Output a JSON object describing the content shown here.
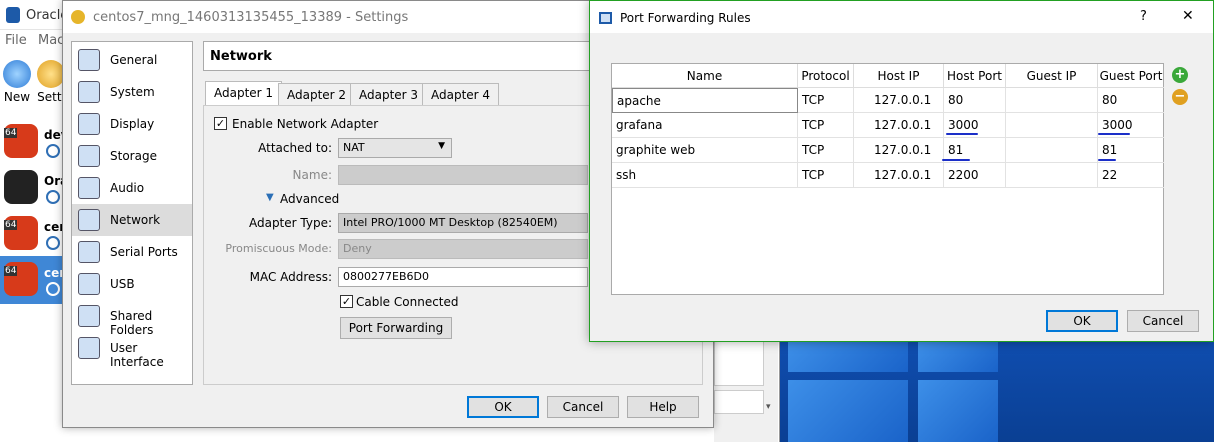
{
  "main_window": {
    "title": "Oracle",
    "menu": [
      "File",
      "Mac"
    ],
    "toolbar": {
      "new_label": "New",
      "settings_label": "Setti"
    },
    "vms": [
      {
        "badge": "64",
        "name": "dev",
        "selected": false
      },
      {
        "badge": "",
        "name": "Ora",
        "selected": false
      },
      {
        "badge": "64",
        "name": "cen",
        "selected": false
      },
      {
        "badge": "64",
        "name": "cen",
        "selected": true
      }
    ]
  },
  "settings": {
    "title": "centos7_mng_1460313135455_13389 - Settings",
    "categories": [
      {
        "label": "General",
        "icon": "general-icon"
      },
      {
        "label": "System",
        "icon": "system-icon"
      },
      {
        "label": "Display",
        "icon": "display-icon"
      },
      {
        "label": "Storage",
        "icon": "storage-icon"
      },
      {
        "label": "Audio",
        "icon": "audio-icon"
      },
      {
        "label": "Network",
        "icon": "network-icon",
        "selected": true
      },
      {
        "label": "Serial Ports",
        "icon": "serial-ports-icon"
      },
      {
        "label": "USB",
        "icon": "usb-icon"
      },
      {
        "label": "Shared Folders",
        "icon": "shared-folders-icon"
      },
      {
        "label": "User Interface",
        "icon": "user-interface-icon"
      }
    ],
    "section_title": "Network",
    "tabs": [
      "Adapter 1",
      "Adapter 2",
      "Adapter 3",
      "Adapter 4"
    ],
    "enable_adapter_label": "Enable Network Adapter",
    "attached_to_label": "Attached to:",
    "attached_to_value": "NAT",
    "name_label": "Name:",
    "advanced_label": "Advanced",
    "adapter_type_label": "Adapter Type:",
    "adapter_type_value": "Intel PRO/1000 MT Desktop (82540EM)",
    "promiscuous_label": "Promiscuous Mode:",
    "promiscuous_value": "Deny",
    "mac_label": "MAC Address:",
    "mac_value": "0800277EB6D0",
    "cable_label": "Cable Connected",
    "port_forwarding_label": "Port Forwarding",
    "ok_label": "OK",
    "cancel_label": "Cancel",
    "help_label": "Help"
  },
  "port_forwarding": {
    "title": "Port Forwarding Rules",
    "help_glyph": "?",
    "close_glyph": "✕",
    "columns": [
      "Name",
      "Protocol",
      "Host IP",
      "Host Port",
      "Guest IP",
      "Guest Port"
    ],
    "rows": [
      {
        "name": "apache",
        "protocol": "TCP",
        "host_ip": "127.0.0.1",
        "host_port": "80",
        "guest_ip": "",
        "guest_port": "80"
      },
      {
        "name": "grafana",
        "protocol": "TCP",
        "host_ip": "127.0.0.1",
        "host_port": "3000",
        "guest_ip": "",
        "guest_port": "3000"
      },
      {
        "name": "graphite web",
        "protocol": "TCP",
        "host_ip": "127.0.0.1",
        "host_port": "81",
        "guest_ip": "",
        "guest_port": "81"
      },
      {
        "name": "ssh",
        "protocol": "TCP",
        "host_ip": "127.0.0.1",
        "host_port": "2200",
        "guest_ip": "",
        "guest_port": "22"
      }
    ],
    "ok_label": "OK",
    "cancel_label": "Cancel"
  },
  "colors": {
    "accent": "#0078d7",
    "selection": "#3f87d6",
    "annotation": "#1b2fc8",
    "pf_border": "#22a022"
  }
}
